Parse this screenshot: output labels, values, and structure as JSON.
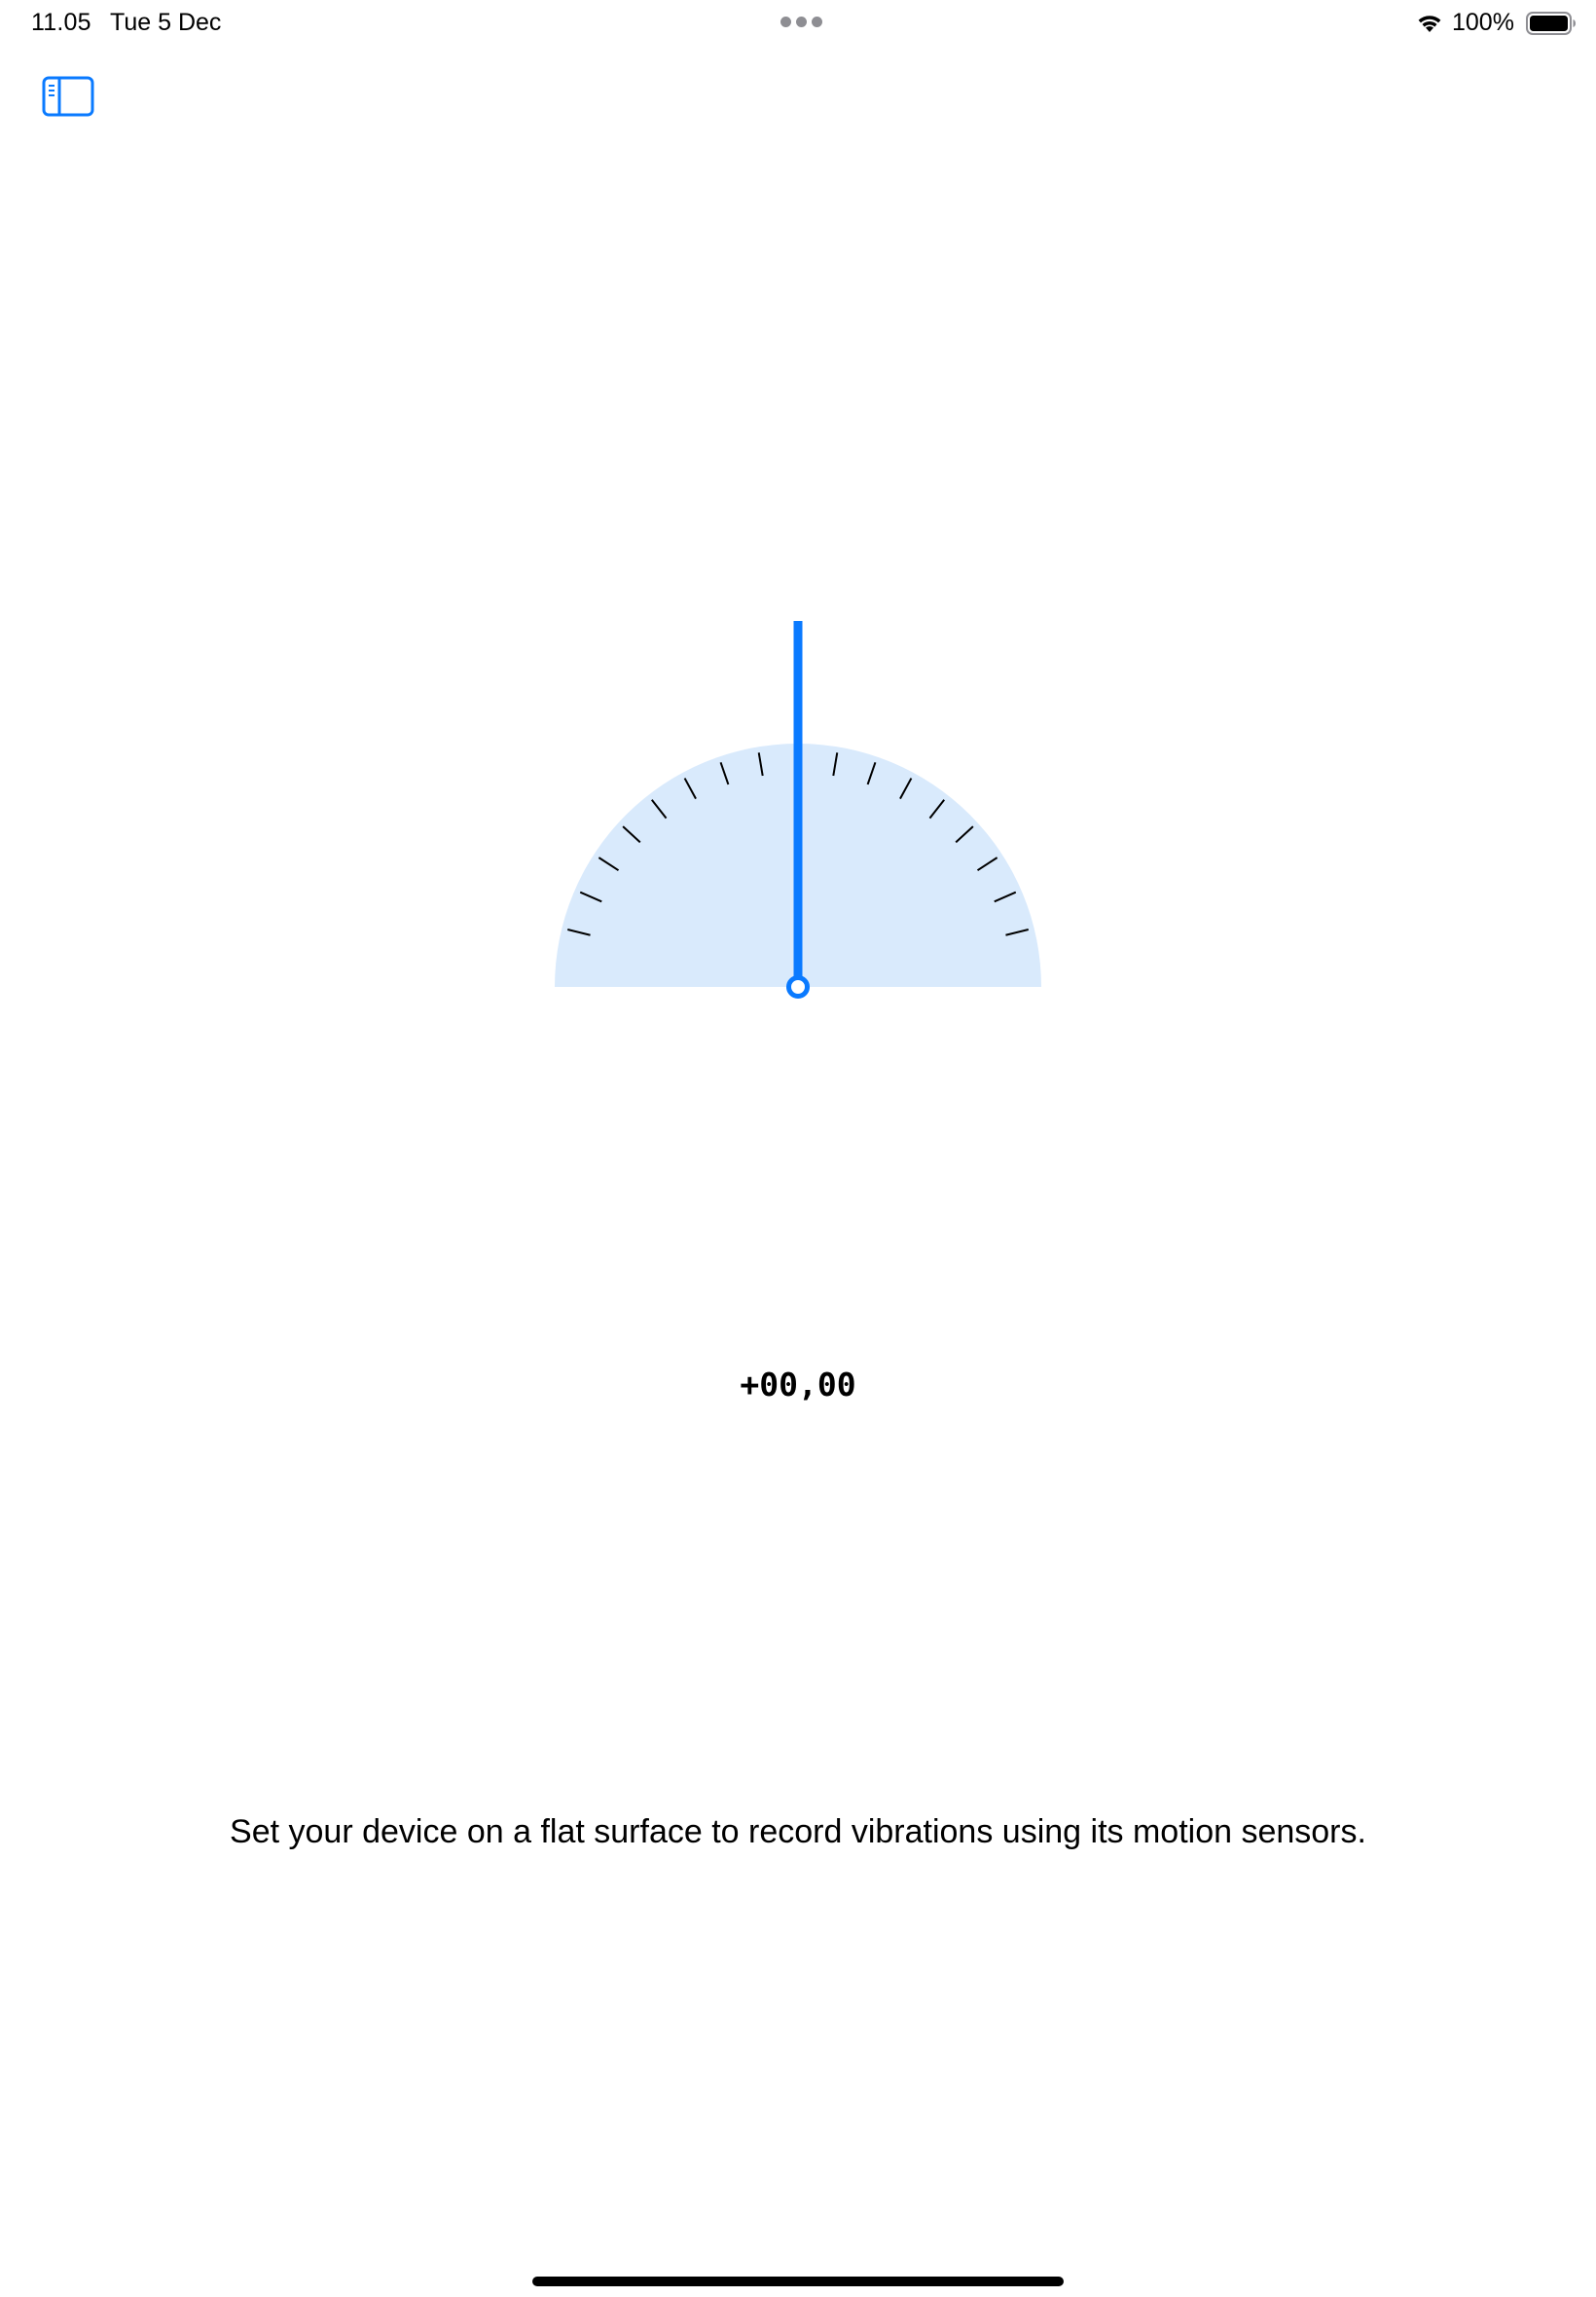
{
  "status_bar": {
    "time": "11.05",
    "date": "Tue 5 Dec",
    "battery_percent": "100%",
    "battery_level": 1.0,
    "icons": [
      "wifi-icon",
      "battery-icon",
      "multitasking-dots-icon"
    ]
  },
  "toolbar": {
    "sidebar_toggle_icon": "sidebar-left-icon"
  },
  "gauge": {
    "needle_angle_degrees": 0,
    "tick_count": 16,
    "accent_color": "#0a7aff",
    "face_color": "#d9eafc"
  },
  "readout": {
    "value": "+00,00"
  },
  "instruction": {
    "text": "Set your device on a flat surface to record vibrations using its motion sensors."
  }
}
